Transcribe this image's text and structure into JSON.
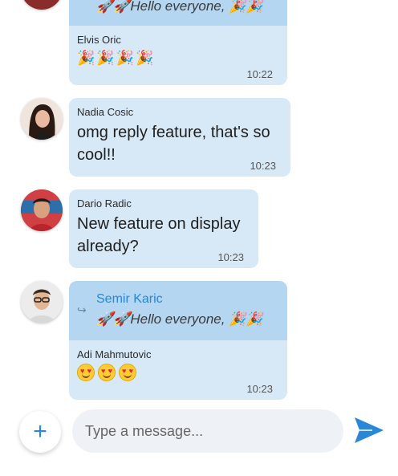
{
  "colors": {
    "bubble": "#d7e8f6",
    "reply_block": "#b4d6f0",
    "accent": "#2a86d6"
  },
  "messages": [
    {
      "sender": "Elvis Oric",
      "reply_fragment": "🚀🚀Hello everyone, 🎉🎉",
      "content_type": "emoji",
      "emoji": [
        "🎉",
        "🎉",
        "🎉",
        "🎉"
      ],
      "time": "10:22"
    },
    {
      "sender": "Nadia Cosic",
      "text": "omg reply feature, that's so cool!!",
      "time": "10:23",
      "avatar": "avatar-woman"
    },
    {
      "sender": "Dario Radic",
      "text": "New feature on display already?",
      "time": "10:23",
      "avatar": "avatar-man-red"
    },
    {
      "sender": "Adi Mahmutovic",
      "reply_to": {
        "name": "Semir Karic",
        "text": "🚀🚀Hello everyone, 🎉🎉"
      },
      "emoji": [
        "heart-eyes",
        "heart-eyes",
        "heart-eyes"
      ],
      "time": "10:23",
      "avatar": "avatar-man-glasses"
    }
  ],
  "composer": {
    "placeholder": "Type a message...",
    "add_icon": "plus-icon",
    "send_icon": "send-icon"
  }
}
